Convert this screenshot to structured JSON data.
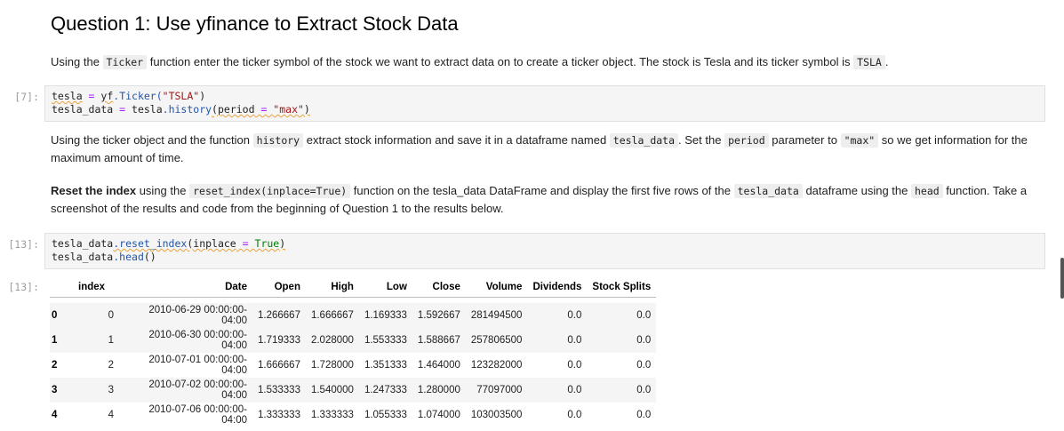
{
  "heading": "Question 1: Use yfinance to Extract Stock Data",
  "para1": {
    "t1": "Using the ",
    "c1": "Ticker",
    "t2": " function enter the ticker symbol of the stock we want to extract data on to create a ticker object. The stock is Tesla and its ticker symbol is ",
    "c2": "TSLA",
    "t3": "."
  },
  "cell1": {
    "prompt": "[7]:",
    "line1_a": "tesla",
    "line1_b": " = ",
    "line1_c": "yf",
    "line1_d": ".Ticker(",
    "line1_e": "\"TSLA\"",
    "line1_f": ")",
    "line2_a": "tesla_data",
    "line2_b": " = ",
    "line2_c": "tesla",
    "line2_d": ".history",
    "line2_e": "(period",
    "line2_f": " = ",
    "line2_g": "\"max\"",
    "line2_h": ")"
  },
  "para2": {
    "t1": "Using the ticker object and the function ",
    "c1": "history",
    "t2": " extract stock information and save it in a dataframe named ",
    "c2": "tesla_data",
    "t3": ". Set the ",
    "c3": "period",
    "t4": " parameter to ",
    "c4": "\"max\"",
    "t5": " so we get information for the maximum amount of time."
  },
  "para3": {
    "b1": "Reset the index",
    "t1": " using the ",
    "c1": "reset_index(inplace=True)",
    "t2": " function on the tesla_data DataFrame and display the first five rows of the ",
    "c2": "tesla_data",
    "t3": " dataframe using the ",
    "c3": "head",
    "t4": " function. Take a screenshot of the results and code from the beginning of Question 1 to the results below."
  },
  "cell2": {
    "prompt": "[13]:",
    "line1_a": "tesla_data",
    "line1_b": ".reset_index",
    "line1_c": "(inplace",
    "line1_d": " = ",
    "line1_e": "True",
    "line1_f": ")",
    "line2_a": "tesla_data",
    "line2_b": ".head",
    "line2_c": "()"
  },
  "output": {
    "prompt": "[13]:",
    "columns": [
      "",
      "index",
      "Date",
      "Open",
      "High",
      "Low",
      "Close",
      "Volume",
      "Dividends",
      "Stock Splits"
    ],
    "rows": [
      [
        "0",
        "0",
        "2010-06-29 00:00:00-04:00",
        "1.266667",
        "1.666667",
        "1.169333",
        "1.592667",
        "281494500",
        "0.0",
        "0.0"
      ],
      [
        "1",
        "1",
        "2010-06-30 00:00:00-04:00",
        "1.719333",
        "2.028000",
        "1.553333",
        "1.588667",
        "257806500",
        "0.0",
        "0.0"
      ],
      [
        "2",
        "2",
        "2010-07-01 00:00:00-04:00",
        "1.666667",
        "1.728000",
        "1.351333",
        "1.464000",
        "123282000",
        "0.0",
        "0.0"
      ],
      [
        "3",
        "3",
        "2010-07-02 00:00:00-04:00",
        "1.533333",
        "1.540000",
        "1.247333",
        "1.280000",
        "77097000",
        "0.0",
        "0.0"
      ],
      [
        "4",
        "4",
        "2010-07-06 00:00:00-04:00",
        "1.333333",
        "1.333333",
        "1.055333",
        "1.074000",
        "103003500",
        "0.0",
        "0.0"
      ]
    ]
  }
}
